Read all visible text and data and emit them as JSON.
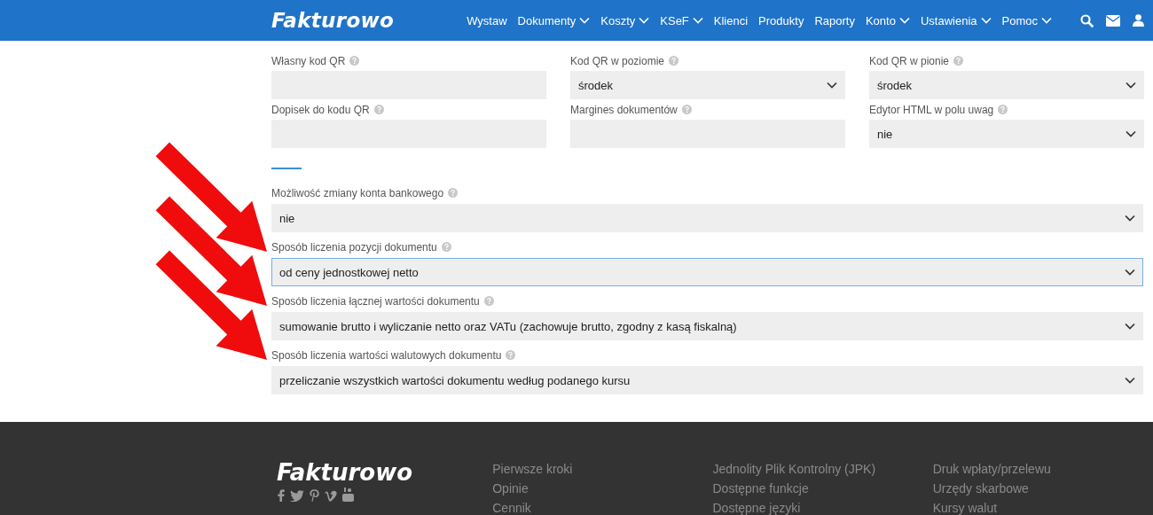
{
  "header": {
    "logo": "Fakturowo",
    "nav": [
      {
        "label": "Wystaw",
        "dropdown": false
      },
      {
        "label": "Dokumenty",
        "dropdown": true
      },
      {
        "label": "Koszty",
        "dropdown": true
      },
      {
        "label": "KSeF",
        "dropdown": true
      },
      {
        "label": "Klienci",
        "dropdown": false
      },
      {
        "label": "Produkty",
        "dropdown": false
      },
      {
        "label": "Raporty",
        "dropdown": false
      },
      {
        "label": "Konto",
        "dropdown": true
      },
      {
        "label": "Ustawienia",
        "dropdown": true
      },
      {
        "label": "Pomoc",
        "dropdown": true
      }
    ]
  },
  "grid_fields": [
    {
      "label": "Własny kod QR",
      "kind": "text"
    },
    {
      "label": "Kod QR w poziomie",
      "kind": "select",
      "value": "środek"
    },
    {
      "label": "Kod QR w pionie",
      "kind": "select",
      "value": "środek"
    },
    {
      "label": "Dopisek do kodu QR",
      "kind": "text"
    },
    {
      "label": "Margines dokumentów",
      "kind": "text"
    },
    {
      "label": "Edytor HTML w polu uwag",
      "kind": "select",
      "value": "nie"
    }
  ],
  "wide_fields": [
    {
      "label": "Możliwość zmiany konta bankowego",
      "kind": "select",
      "value": "nie",
      "focused": false,
      "arrow": false
    },
    {
      "label": "Sposób liczenia pozycji dokumentu",
      "kind": "select",
      "value": "od ceny jednostkowej netto",
      "focused": true,
      "arrow": true
    },
    {
      "label": "Sposób liczenia łącznej wartości dokumentu",
      "kind": "select",
      "value": "sumowanie brutto i wyliczanie netto oraz VATu (zachowuje brutto, zgodny z kasą fiskalną)",
      "focused": false,
      "arrow": true
    },
    {
      "label": "Sposób liczenia wartości walutowych dokumentu",
      "kind": "select",
      "value": "przeliczanie wszystkich wartości dokumentu według podanego kursu",
      "focused": false,
      "arrow": true
    }
  ],
  "footer": {
    "logo": "Fakturowo",
    "columns": [
      [
        "Pierwsze kroki",
        "Opinie",
        "Cennik"
      ],
      [
        "Jednolity Plik Kontrolny (JPK)",
        "Dostępne funkcje",
        "Dostępne języki"
      ],
      [
        "Druk wpłaty/przelewu",
        "Urzędy skarbowe",
        "Kursy walut"
      ]
    ]
  }
}
